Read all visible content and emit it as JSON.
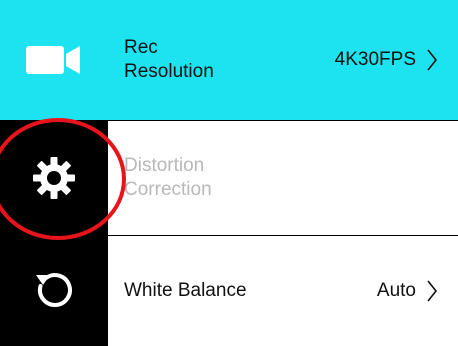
{
  "menu": {
    "items": [
      {
        "id": "rec-resolution",
        "icon": "video-camera-icon",
        "label_line1": "Rec",
        "label_line2": "Resolution",
        "value": "4K30FPS",
        "selected": true,
        "enabled": true
      },
      {
        "id": "distortion-correction",
        "icon": "gear-icon",
        "label_line1": "Distortion",
        "label_line2": "Correction",
        "value": "",
        "selected": false,
        "enabled": false
      },
      {
        "id": "white-balance",
        "icon": "reset-icon",
        "label_line1": "White Balance",
        "value": "Auto",
        "selected": false,
        "enabled": true
      }
    ]
  },
  "colors": {
    "selected_row": "#1de3f0",
    "icon_column": "#000000",
    "highlight_ring": "#e8141c",
    "disabled_text": "#b8b8b8"
  }
}
